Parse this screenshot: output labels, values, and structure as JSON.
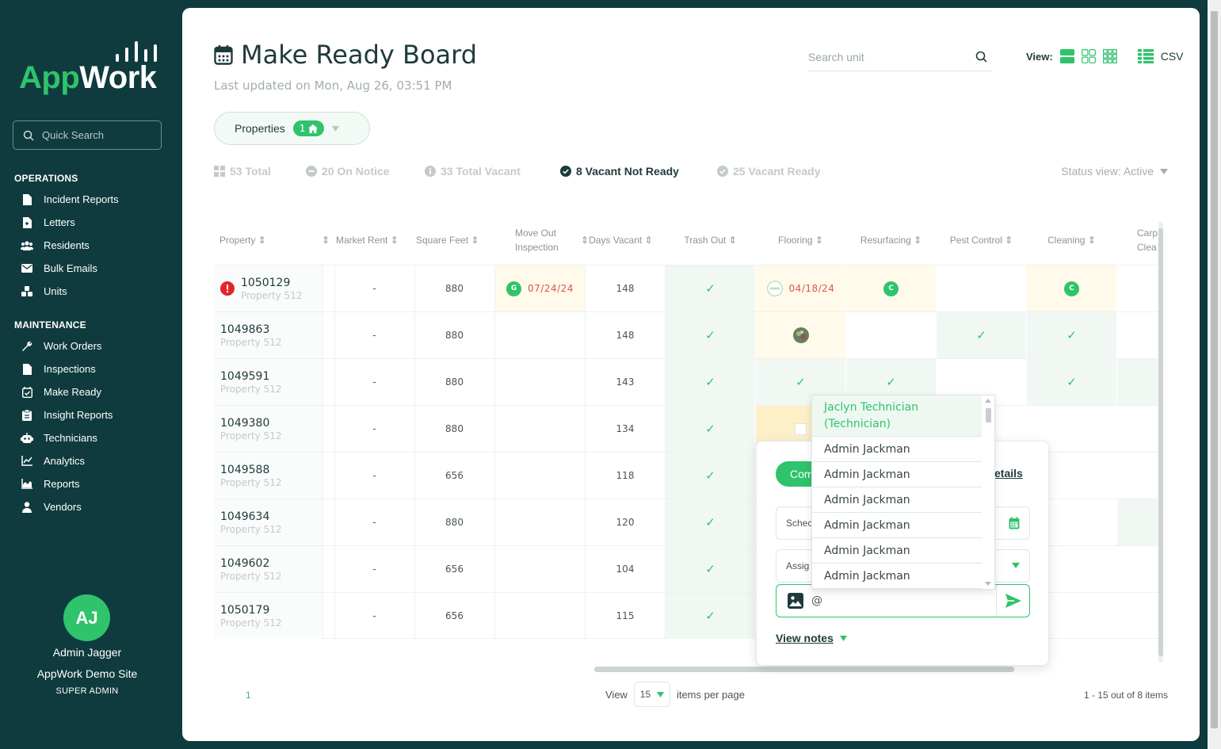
{
  "brand": {
    "logo_app": "App",
    "logo_work": "Work"
  },
  "sidebar": {
    "quick_search_placeholder": "Quick Search",
    "operations_heading": "OPERATIONS",
    "operations": [
      {
        "label": "Incident Reports",
        "icon": "document-icon"
      },
      {
        "label": "Letters",
        "icon": "letter-icon"
      },
      {
        "label": "Residents",
        "icon": "users-icon"
      },
      {
        "label": "Bulk Emails",
        "icon": "envelope-icon"
      },
      {
        "label": "Units",
        "icon": "units-icon"
      }
    ],
    "maintenance_heading": "MAINTENANCE",
    "maintenance": [
      {
        "label": "Work Orders",
        "icon": "wrench-icon"
      },
      {
        "label": "Inspections",
        "icon": "document-icon"
      },
      {
        "label": "Make Ready",
        "icon": "calendar-check-icon"
      },
      {
        "label": "Insight Reports",
        "icon": "clipboard-icon"
      },
      {
        "label": "Technicians",
        "icon": "robot-icon"
      },
      {
        "label": "Analytics",
        "icon": "line-chart-icon"
      },
      {
        "label": "Reports",
        "icon": "area-chart-icon"
      },
      {
        "label": "Vendors",
        "icon": "person-icon"
      }
    ],
    "user": {
      "initials": "AJ",
      "name": "Admin Jagger",
      "site": "AppWork Demo Site",
      "role": "SUPER ADMIN"
    }
  },
  "header": {
    "title": "Make Ready Board",
    "subtitle": "Last updated on Mon, Aug 26, 03:51 PM",
    "search_placeholder": "Search unit",
    "view_label": "View:",
    "csv_label": "CSV"
  },
  "properties_filter": {
    "label": "Properties",
    "count": "1"
  },
  "stats": {
    "total": "53 Total",
    "on_notice": "20 On Notice",
    "total_vacant": "33 Total Vacant",
    "vacant_not_ready": "8 Vacant Not Ready",
    "vacant_ready": "25 Vacant Ready",
    "status_view": "Status view: Active"
  },
  "table": {
    "headers": {
      "property": "Property",
      "market_rent": "Market Rent",
      "square_feet": "Square Feet",
      "move_out_1": "Move Out",
      "move_out_2": "Inspection",
      "days_vacant": "Days Vacant",
      "trash_out": "Trash Out",
      "flooring": "Flooring",
      "resurfacing": "Resurfacing",
      "pest_control": "Pest Control",
      "cleaning": "Cleaning",
      "carpet_1": "Carp",
      "carpet_2": "Clea"
    },
    "rows": [
      {
        "unit": "1050129",
        "property": "Property 512",
        "rent": "-",
        "sqft": "880",
        "days": "148",
        "moveout_badge": "G",
        "moveout_date": "07/24/24",
        "flooring_date": "04/18/24",
        "resurf_badge": "C",
        "cleaning_badge": "C"
      },
      {
        "unit": "1049863",
        "property": "Property 512",
        "rent": "-",
        "sqft": "880",
        "days": "148"
      },
      {
        "unit": "1049591",
        "property": "Property 512",
        "rent": "-",
        "sqft": "880",
        "days": "143"
      },
      {
        "unit": "1049380",
        "property": "Property 512",
        "rent": "-",
        "sqft": "880",
        "days": "134"
      },
      {
        "unit": "1049588",
        "property": "Property 512",
        "rent": "-",
        "sqft": "656",
        "days": "118"
      },
      {
        "unit": "1049634",
        "property": "Property 512",
        "rent": "-",
        "sqft": "880",
        "days": "120"
      },
      {
        "unit": "1049602",
        "property": "Property 512",
        "rent": "-",
        "sqft": "656",
        "days": "104"
      },
      {
        "unit": "1050179",
        "property": "Property 512",
        "rent": "-",
        "sqft": "656",
        "days": "115"
      }
    ]
  },
  "pagination": {
    "page": "1",
    "view_label": "View",
    "per_page": "15",
    "per_page_suffix": "items per page",
    "count": "1 - 15 out of 8 items"
  },
  "popover": {
    "complete_label": "Com",
    "details_label": "etails",
    "schedule_placeholder": "Schec",
    "assign_placeholder": "Assig",
    "note_value": "@",
    "view_notes": "View notes"
  },
  "assign_dropdown": {
    "first": "Jaclyn Technician (Technician)",
    "items": [
      "Admin Jackman",
      "Admin Jackman",
      "Admin Jackman",
      "Admin Jackman",
      "Admin Jackman",
      "Admin Jackman"
    ]
  },
  "colors": {
    "sidebar_bg": "#0f3b3e",
    "accent": "#2fc36b",
    "danger": "#e05252"
  }
}
